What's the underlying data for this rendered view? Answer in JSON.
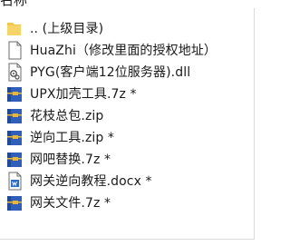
{
  "header": {
    "column_name": "名称"
  },
  "files": [
    {
      "icon": "folder-up-icon",
      "name": ".. (上级目录)",
      "kind": "parent"
    },
    {
      "icon": "text-file-icon",
      "name": "HuaZhi（修改里面的授权地址）",
      "kind": "txt"
    },
    {
      "icon": "dll-file-icon",
      "name": "PYG(客户端12位服务器).dll",
      "kind": "dll"
    },
    {
      "icon": "archive-icon",
      "name": "UPX加壳工具.7z *",
      "kind": "archive"
    },
    {
      "icon": "archive-icon",
      "name": "花枝总包.zip",
      "kind": "archive"
    },
    {
      "icon": "archive-icon",
      "name": "逆向工具.zip *",
      "kind": "archive"
    },
    {
      "icon": "archive-icon",
      "name": "网吧替换.7z *",
      "kind": "archive"
    },
    {
      "icon": "word-document-icon",
      "name": "网关逆向教程.docx *",
      "kind": "docx"
    },
    {
      "icon": "archive-icon",
      "name": "网关文件.7z *",
      "kind": "archive"
    }
  ],
  "colors": {
    "folder": "#f3c54a",
    "archive_blue": "#2f5fb8",
    "archive_band": "#e9b43a",
    "word_blue": "#2b6cc4",
    "text": "#1a1a1a"
  }
}
